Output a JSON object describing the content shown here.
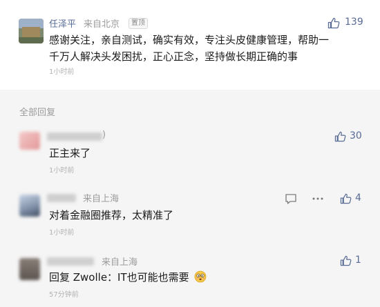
{
  "colors": {
    "name": "#576b95",
    "meta": "#9b9b9b",
    "divider_band": "#f5f5f5",
    "like": "#576b95"
  },
  "pinned": {
    "name": "任泽平",
    "location": "来自北京",
    "badge": "置顶",
    "likes": "139",
    "content_line1": "感谢关注，亲自测试，确实有效，专注头皮健康管理，帮助一",
    "content_line2": "千万人解决头发困扰，正心正念，坚持做长期正确的事",
    "time": "1小时前"
  },
  "section": {
    "title": "全部回复"
  },
  "replies": [
    {
      "name_suffix": ")",
      "likes": "30",
      "content": "正主来了",
      "time": "1小时前"
    },
    {
      "location": "来自上海",
      "likes": "4",
      "content": "对着金融圈推荐，太精准了",
      "time": "1小时前",
      "actions": [
        "comment-icon",
        "more-icon",
        "like-icon"
      ]
    },
    {
      "location": "来自上海",
      "likes": "1",
      "content": "回复 Zwolle：IT也可能也需要",
      "time": "57分钟前"
    }
  ]
}
